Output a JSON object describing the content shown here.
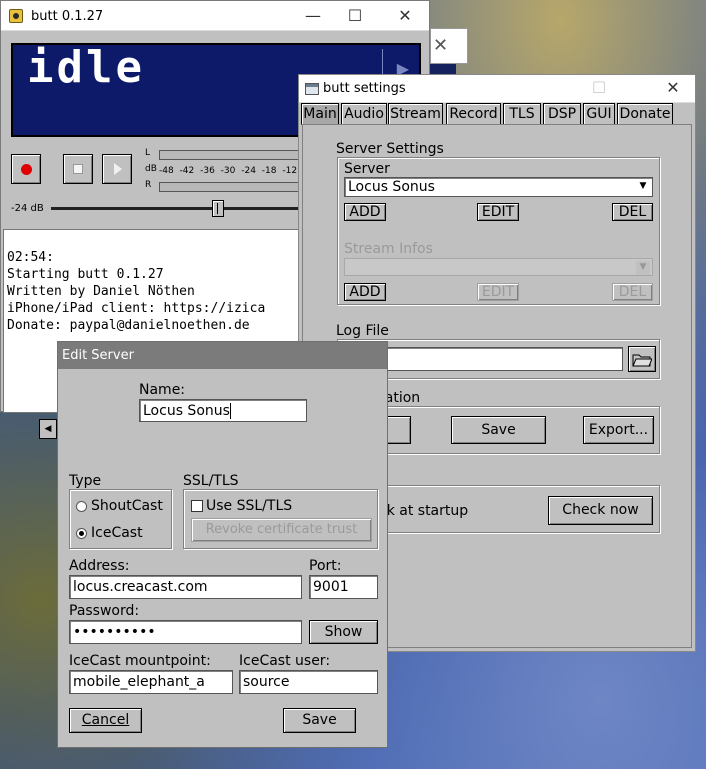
{
  "main_window": {
    "title": "butt 0.1.27",
    "display_text": "idle",
    "vu_left_label": "L",
    "vu_db_label": "dB",
    "vu_right_label": "R",
    "vu_ticks": "-48 -42 -36 -30 -24 -18 -12",
    "gain_label": "-24 dB",
    "log_lines": [
      "02:54:",
      "Starting butt 0.1.27",
      "Written by Daniel Nöthen",
      "iPhone/iPad client: https://izica",
      "Donate: paypal@danielnoethen.de"
    ]
  },
  "settings_window": {
    "title": "butt settings",
    "tabs": [
      "Main",
      "Audio",
      "Stream",
      "Record",
      "TLS",
      "DSP",
      "GUI",
      "Donate"
    ],
    "active_tab": "Main",
    "server_settings_heading": "Server Settings",
    "server_label": "Server",
    "server_selected": "Locus Sonus",
    "add_label": "ADD",
    "edit_label": "EDIT",
    "del_label": "DEL",
    "stream_infos_label": "Stream Infos",
    "log_file_heading": "Log File",
    "configuration_heading": "ration",
    "import_label_partial": "t...",
    "save_label": "Save",
    "export_label": "Export...",
    "update_check_text_partial": "ck at startup",
    "check_now_label": "Check now"
  },
  "edit_server": {
    "title": "Edit Server",
    "name_label": "Name:",
    "name_value": "Locus Sonus",
    "type_label": "Type",
    "shoutcast_label": "ShoutCast",
    "icecast_label": "IceCast",
    "selected_type": "IceCast",
    "ssl_label": "SSL/TLS",
    "use_ssl_label": "Use SSL/TLS",
    "revoke_label": "Revoke certificate trust",
    "address_label": "Address:",
    "address_value": "locus.creacast.com",
    "port_label": "Port:",
    "port_value": "9001",
    "password_label": "Password:",
    "password_value": "••••••••••",
    "show_label": "Show",
    "mountpoint_label": "IceCast mountpoint:",
    "mountpoint_value": "mobile_elephant_a",
    "user_label": "IceCast user:",
    "user_value": "source",
    "cancel_label": "Cancel",
    "save_label": "Save"
  },
  "colors": {
    "lcd_background": "#0d1a6a",
    "record_red": "#e00000",
    "dialog_title": "#7b7b7b",
    "window_face": "#c0c0c0"
  }
}
